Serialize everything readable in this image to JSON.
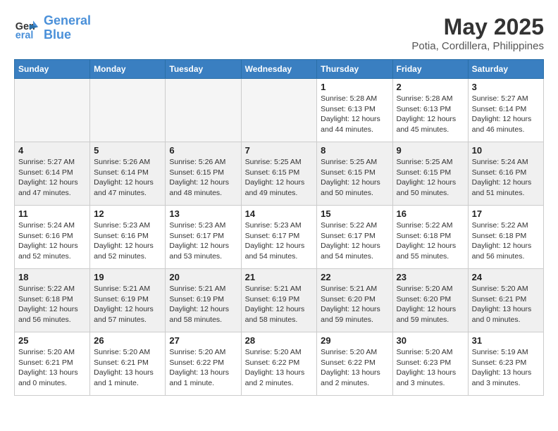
{
  "header": {
    "logo_line1": "General",
    "logo_line2": "Blue",
    "month": "May 2025",
    "location": "Potia, Cordillera, Philippines"
  },
  "weekdays": [
    "Sunday",
    "Monday",
    "Tuesday",
    "Wednesday",
    "Thursday",
    "Friday",
    "Saturday"
  ],
  "weeks": [
    [
      {
        "day": "",
        "empty": true
      },
      {
        "day": "",
        "empty": true
      },
      {
        "day": "",
        "empty": true
      },
      {
        "day": "",
        "empty": true
      },
      {
        "day": "1",
        "sunrise": "5:28 AM",
        "sunset": "6:13 PM",
        "daylight": "12 hours and 44 minutes."
      },
      {
        "day": "2",
        "sunrise": "5:28 AM",
        "sunset": "6:13 PM",
        "daylight": "12 hours and 45 minutes."
      },
      {
        "day": "3",
        "sunrise": "5:27 AM",
        "sunset": "6:14 PM",
        "daylight": "12 hours and 46 minutes."
      }
    ],
    [
      {
        "day": "4",
        "sunrise": "5:27 AM",
        "sunset": "6:14 PM",
        "daylight": "12 hours and 47 minutes."
      },
      {
        "day": "5",
        "sunrise": "5:26 AM",
        "sunset": "6:14 PM",
        "daylight": "12 hours and 47 minutes."
      },
      {
        "day": "6",
        "sunrise": "5:26 AM",
        "sunset": "6:15 PM",
        "daylight": "12 hours and 48 minutes."
      },
      {
        "day": "7",
        "sunrise": "5:25 AM",
        "sunset": "6:15 PM",
        "daylight": "12 hours and 49 minutes."
      },
      {
        "day": "8",
        "sunrise": "5:25 AM",
        "sunset": "6:15 PM",
        "daylight": "12 hours and 50 minutes."
      },
      {
        "day": "9",
        "sunrise": "5:25 AM",
        "sunset": "6:15 PM",
        "daylight": "12 hours and 50 minutes."
      },
      {
        "day": "10",
        "sunrise": "5:24 AM",
        "sunset": "6:16 PM",
        "daylight": "12 hours and 51 minutes."
      }
    ],
    [
      {
        "day": "11",
        "sunrise": "5:24 AM",
        "sunset": "6:16 PM",
        "daylight": "12 hours and 52 minutes."
      },
      {
        "day": "12",
        "sunrise": "5:23 AM",
        "sunset": "6:16 PM",
        "daylight": "12 hours and 52 minutes."
      },
      {
        "day": "13",
        "sunrise": "5:23 AM",
        "sunset": "6:17 PM",
        "daylight": "12 hours and 53 minutes."
      },
      {
        "day": "14",
        "sunrise": "5:23 AM",
        "sunset": "6:17 PM",
        "daylight": "12 hours and 54 minutes."
      },
      {
        "day": "15",
        "sunrise": "5:22 AM",
        "sunset": "6:17 PM",
        "daylight": "12 hours and 54 minutes."
      },
      {
        "day": "16",
        "sunrise": "5:22 AM",
        "sunset": "6:18 PM",
        "daylight": "12 hours and 55 minutes."
      },
      {
        "day": "17",
        "sunrise": "5:22 AM",
        "sunset": "6:18 PM",
        "daylight": "12 hours and 56 minutes."
      }
    ],
    [
      {
        "day": "18",
        "sunrise": "5:22 AM",
        "sunset": "6:18 PM",
        "daylight": "12 hours and 56 minutes."
      },
      {
        "day": "19",
        "sunrise": "5:21 AM",
        "sunset": "6:19 PM",
        "daylight": "12 hours and 57 minutes."
      },
      {
        "day": "20",
        "sunrise": "5:21 AM",
        "sunset": "6:19 PM",
        "daylight": "12 hours and 58 minutes."
      },
      {
        "day": "21",
        "sunrise": "5:21 AM",
        "sunset": "6:19 PM",
        "daylight": "12 hours and 58 minutes."
      },
      {
        "day": "22",
        "sunrise": "5:21 AM",
        "sunset": "6:20 PM",
        "daylight": "12 hours and 59 minutes."
      },
      {
        "day": "23",
        "sunrise": "5:20 AM",
        "sunset": "6:20 PM",
        "daylight": "12 hours and 59 minutes."
      },
      {
        "day": "24",
        "sunrise": "5:20 AM",
        "sunset": "6:21 PM",
        "daylight": "13 hours and 0 minutes."
      }
    ],
    [
      {
        "day": "25",
        "sunrise": "5:20 AM",
        "sunset": "6:21 PM",
        "daylight": "13 hours and 0 minutes."
      },
      {
        "day": "26",
        "sunrise": "5:20 AM",
        "sunset": "6:21 PM",
        "daylight": "13 hours and 1 minute."
      },
      {
        "day": "27",
        "sunrise": "5:20 AM",
        "sunset": "6:22 PM",
        "daylight": "13 hours and 1 minute."
      },
      {
        "day": "28",
        "sunrise": "5:20 AM",
        "sunset": "6:22 PM",
        "daylight": "13 hours and 2 minutes."
      },
      {
        "day": "29",
        "sunrise": "5:20 AM",
        "sunset": "6:22 PM",
        "daylight": "13 hours and 2 minutes."
      },
      {
        "day": "30",
        "sunrise": "5:20 AM",
        "sunset": "6:23 PM",
        "daylight": "13 hours and 3 minutes."
      },
      {
        "day": "31",
        "sunrise": "5:19 AM",
        "sunset": "6:23 PM",
        "daylight": "13 hours and 3 minutes."
      }
    ]
  ],
  "labels": {
    "sunrise": "Sunrise:",
    "sunset": "Sunset:",
    "daylight": "Daylight:"
  }
}
